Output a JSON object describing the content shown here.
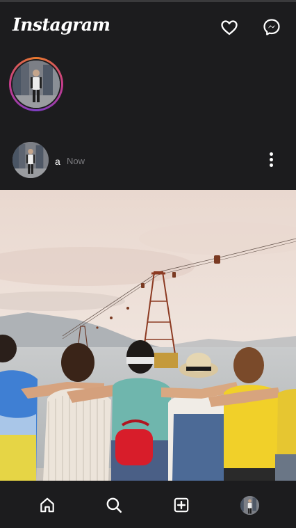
{
  "app": {
    "logo_text": "Instagram"
  },
  "header": {
    "icons": [
      "heart-icon",
      "messenger-icon"
    ]
  },
  "stories": [
    {
      "ring_colors": [
        "#e8792b",
        "#c63b8b",
        "#7d3fc4"
      ]
    }
  ],
  "post": {
    "username": "a",
    "time": "Now",
    "menu_icon": "more-vertical-icon",
    "image_description_icon": "photo-icon"
  },
  "bottom_nav": {
    "items": [
      "home-icon",
      "search-icon",
      "add-post-icon",
      "profile-avatar"
    ]
  },
  "colors": {
    "background": "#1c1c1e",
    "text": "#ffffff",
    "muted": "#7c7c80"
  }
}
